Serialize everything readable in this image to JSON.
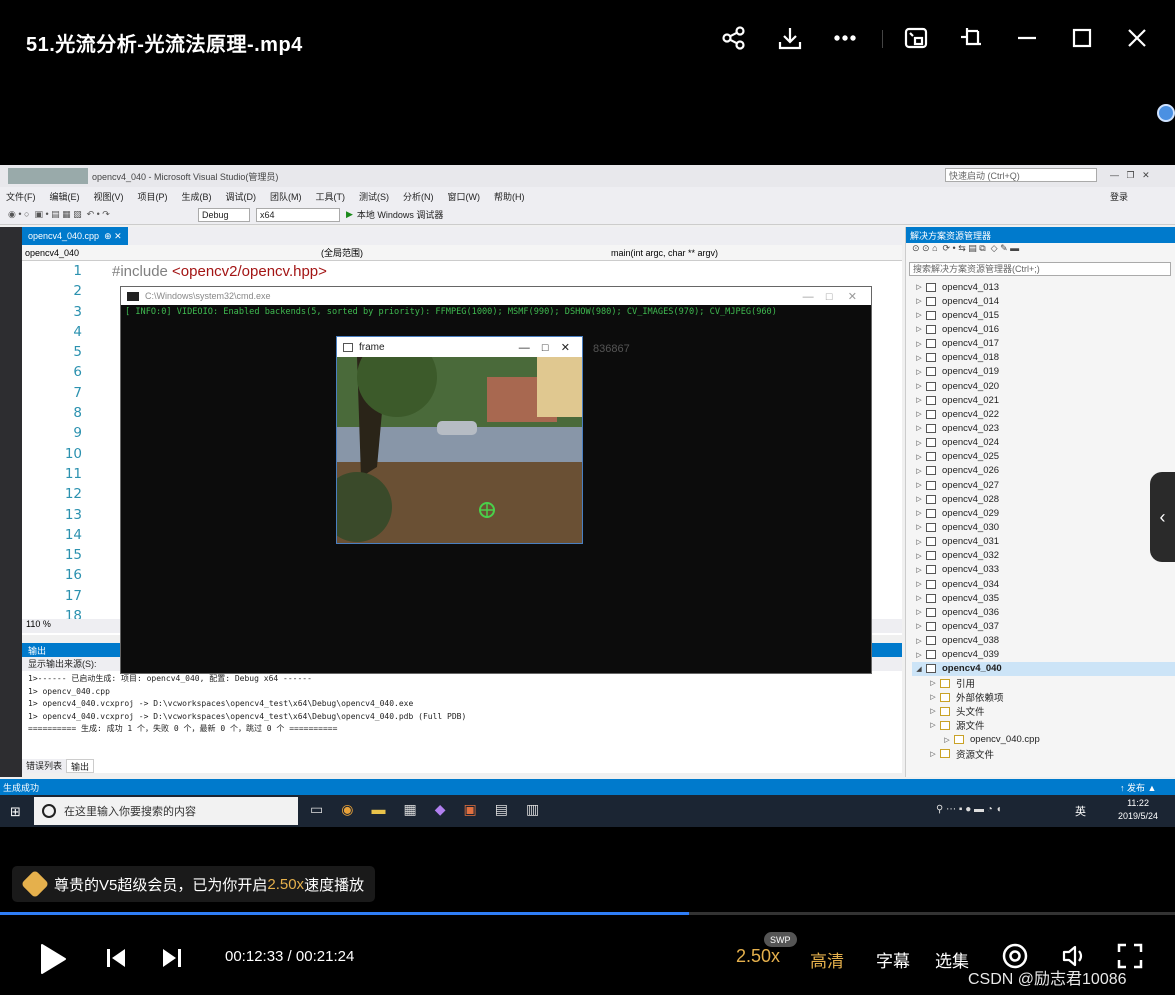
{
  "player": {
    "title": "51.光流分析-光流法原理-.mp4",
    "vip_message_prefix": "尊贵的V5超级会员，已为你开启",
    "vip_speed": "2.50x",
    "vip_message_suffix": "速度播放",
    "current_time": "00:12:33",
    "separator": " / ",
    "total_time": "00:21:24",
    "progress_fraction": 0.586,
    "speed_label": "2.50x",
    "speed_badge": "SWP",
    "quality_label": "高清",
    "subtitle_label": "字幕",
    "episodes_label": "选集",
    "watermark": "CSDN @励志君10086",
    "accent_color": "#e5b04c",
    "progress_color": "#2f7ef7"
  },
  "vs": {
    "window_title": "opencv4_040 - Microsoft Visual Studio(管理员)",
    "quick_launch": "快速启动 (Ctrl+Q)",
    "login": "登录",
    "menu": [
      "文件(F)",
      "编辑(E)",
      "视图(V)",
      "项目(P)",
      "生成(B)",
      "调试(D)",
      "团队(M)",
      "工具(T)",
      "测试(S)",
      "分析(N)",
      "窗口(W)",
      "帮助(H)"
    ],
    "config": "Debug",
    "platform": "x64",
    "run_label": "本地 Windows 调试器",
    "doc_tab": "opencv4_040.cpp",
    "nav_project": "opencv4_040",
    "nav_scope": "(全局范围)",
    "nav_member": "main(int argc, char ** argv)",
    "line_numbers": [
      "1",
      "2",
      "3",
      "4",
      "5",
      "6",
      "7",
      "8",
      "9",
      "10",
      "11",
      "12",
      "13",
      "14",
      "15",
      "16",
      "17",
      "18"
    ],
    "code_line1_kw": "#include ",
    "code_line1_path": "<opencv2/opencv.hpp>",
    "zoom": "110 %",
    "output_title": "输出",
    "output_source_label": "显示输出来源(S):",
    "output_lines": [
      "1>------ 已启动生成: 项目: opencv4_040, 配置: Debug x64 ------",
      "1>  opencv_040.cpp",
      "1>  opencv4_040.vcxproj -> D:\\vcworkspaces\\opencv4_test\\x64\\Debug\\opencv4_040.exe",
      "1>  opencv4_040.vcxproj -> D:\\vcworkspaces\\opencv4_test\\x64\\Debug\\opencv4_040.pdb (Full PDB)",
      "========== 生成: 成功 1 个，失败 0 个，最新 0 个，跳过 0 个 =========="
    ],
    "bottom_tab_errors": "错误列表",
    "bottom_tab_output": "输出",
    "status_left": "生成成功",
    "status_right": "↑ 发布 ▲",
    "solution_title": "解决方案资源管理器",
    "solution_search": "搜索解决方案资源管理器(Ctrl+;)",
    "projects": [
      "opencv4_013",
      "opencv4_014",
      "opencv4_015",
      "opencv4_016",
      "opencv4_017",
      "opencv4_018",
      "opencv4_019",
      "opencv4_020",
      "opencv4_021",
      "opencv4_022",
      "opencv4_023",
      "opencv4_024",
      "opencv4_025",
      "opencv4_026",
      "opencv4_027",
      "opencv4_028",
      "opencv4_029",
      "opencv4_030",
      "opencv4_031",
      "opencv4_032",
      "opencv4_033",
      "opencv4_034",
      "opencv4_035",
      "opencv4_036",
      "opencv4_037",
      "opencv4_038",
      "opencv4_039"
    ],
    "active_project": "opencv4_040",
    "sub_items": [
      "引用",
      "外部依赖项",
      "头文件",
      "源文件",
      "opencv_040.cpp",
      "资源文件"
    ],
    "cmd_title": "C:\\Windows\\system32\\cmd.exe",
    "cmd_line": "[ INFO:0] VIDEOIO: Enabled backends(5, sorted by priority): FFMPEG(1000); MSMF(990); DSHOW(980); CV_IMAGES(970); CV_MJPEG(960)",
    "frame_title": "frame",
    "overlay_number": "836867"
  },
  "taskbar": {
    "search_placeholder": "在这里输入你要搜索的内容",
    "time": "11:22",
    "date": "2019/5/24",
    "ime": "英"
  }
}
